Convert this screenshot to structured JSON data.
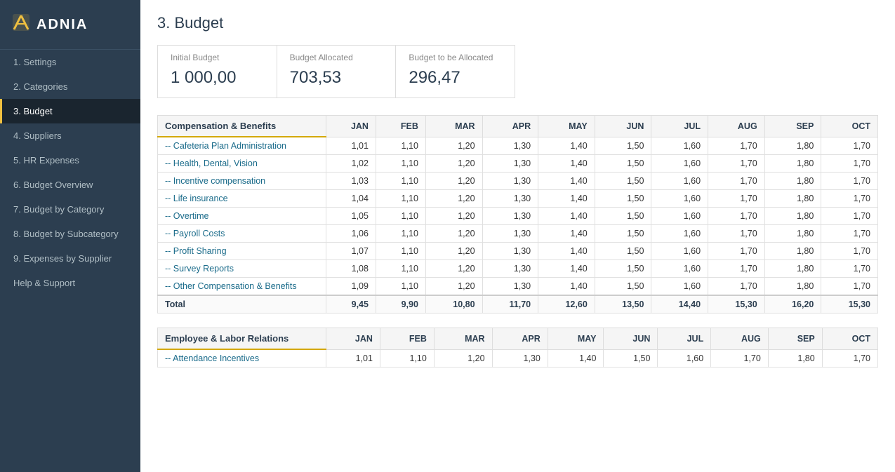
{
  "sidebar": {
    "logo_icon": "⟋",
    "logo_text": "ADNIA",
    "nav_items": [
      {
        "label": "1. Settings",
        "id": "settings",
        "active": false
      },
      {
        "label": "2. Categories",
        "id": "categories",
        "active": false
      },
      {
        "label": "3. Budget",
        "id": "budget",
        "active": true
      },
      {
        "label": "4. Suppliers",
        "id": "suppliers",
        "active": false
      },
      {
        "label": "5. HR Expenses",
        "id": "hr-expenses",
        "active": false
      },
      {
        "label": "6. Budget Overview",
        "id": "budget-overview",
        "active": false
      },
      {
        "label": "7. Budget by Category",
        "id": "budget-by-category",
        "active": false
      },
      {
        "label": "8. Budget by Subcategory",
        "id": "budget-by-subcategory",
        "active": false
      },
      {
        "label": "9. Expenses by Supplier",
        "id": "expenses-by-supplier",
        "active": false
      },
      {
        "label": "Help & Support",
        "id": "help-support",
        "active": false
      }
    ]
  },
  "page": {
    "title": "3. Budget"
  },
  "summary": {
    "initial_budget_label": "Initial Budget",
    "initial_budget_value": "1 000,00",
    "budget_allocated_label": "Budget Allocated",
    "budget_allocated_value": "703,53",
    "budget_to_allocate_label": "Budget to be Allocated",
    "budget_to_allocate_value": "296,47"
  },
  "table1": {
    "category": "Compensation & Benefits",
    "columns": [
      "JAN",
      "FEB",
      "MAR",
      "APR",
      "MAY",
      "JUN",
      "JUL",
      "AUG",
      "SEP",
      "OCT"
    ],
    "rows": [
      {
        "label": "-- Cafeteria Plan Administration",
        "values": [
          "1,01",
          "1,10",
          "1,20",
          "1,30",
          "1,40",
          "1,50",
          "1,60",
          "1,70",
          "1,80",
          "1,70"
        ]
      },
      {
        "label": "-- Health, Dental, Vision",
        "values": [
          "1,02",
          "1,10",
          "1,20",
          "1,30",
          "1,40",
          "1,50",
          "1,60",
          "1,70",
          "1,80",
          "1,70"
        ]
      },
      {
        "label": "-- Incentive compensation",
        "values": [
          "1,03",
          "1,10",
          "1,20",
          "1,30",
          "1,40",
          "1,50",
          "1,60",
          "1,70",
          "1,80",
          "1,70"
        ]
      },
      {
        "label": "-- Life insurance",
        "values": [
          "1,04",
          "1,10",
          "1,20",
          "1,30",
          "1,40",
          "1,50",
          "1,60",
          "1,70",
          "1,80",
          "1,70"
        ]
      },
      {
        "label": "-- Overtime",
        "values": [
          "1,05",
          "1,10",
          "1,20",
          "1,30",
          "1,40",
          "1,50",
          "1,60",
          "1,70",
          "1,80",
          "1,70"
        ]
      },
      {
        "label": "-- Payroll Costs",
        "values": [
          "1,06",
          "1,10",
          "1,20",
          "1,30",
          "1,40",
          "1,50",
          "1,60",
          "1,70",
          "1,80",
          "1,70"
        ]
      },
      {
        "label": "-- Profit Sharing",
        "values": [
          "1,07",
          "1,10",
          "1,20",
          "1,30",
          "1,40",
          "1,50",
          "1,60",
          "1,70",
          "1,80",
          "1,70"
        ]
      },
      {
        "label": "-- Survey Reports",
        "values": [
          "1,08",
          "1,10",
          "1,20",
          "1,30",
          "1,40",
          "1,50",
          "1,60",
          "1,70",
          "1,80",
          "1,70"
        ]
      },
      {
        "label": "-- Other Compensation & Benefits",
        "values": [
          "1,09",
          "1,10",
          "1,20",
          "1,30",
          "1,40",
          "1,50",
          "1,60",
          "1,70",
          "1,80",
          "1,70"
        ]
      }
    ],
    "total": {
      "label": "Total",
      "values": [
        "9,45",
        "9,90",
        "10,80",
        "11,70",
        "12,60",
        "13,50",
        "14,40",
        "15,30",
        "16,20",
        "15,30"
      ]
    }
  },
  "table2": {
    "category": "Employee & Labor Relations",
    "columns": [
      "JAN",
      "FEB",
      "MAR",
      "APR",
      "MAY",
      "JUN",
      "JUL",
      "AUG",
      "SEP",
      "OCT"
    ],
    "rows": [
      {
        "label": "-- Attendance Incentives",
        "values": [
          "1,01",
          "1,10",
          "1,20",
          "1,30",
          "1,40",
          "1,50",
          "1,60",
          "1,70",
          "1,80",
          "1,70"
        ]
      }
    ]
  }
}
